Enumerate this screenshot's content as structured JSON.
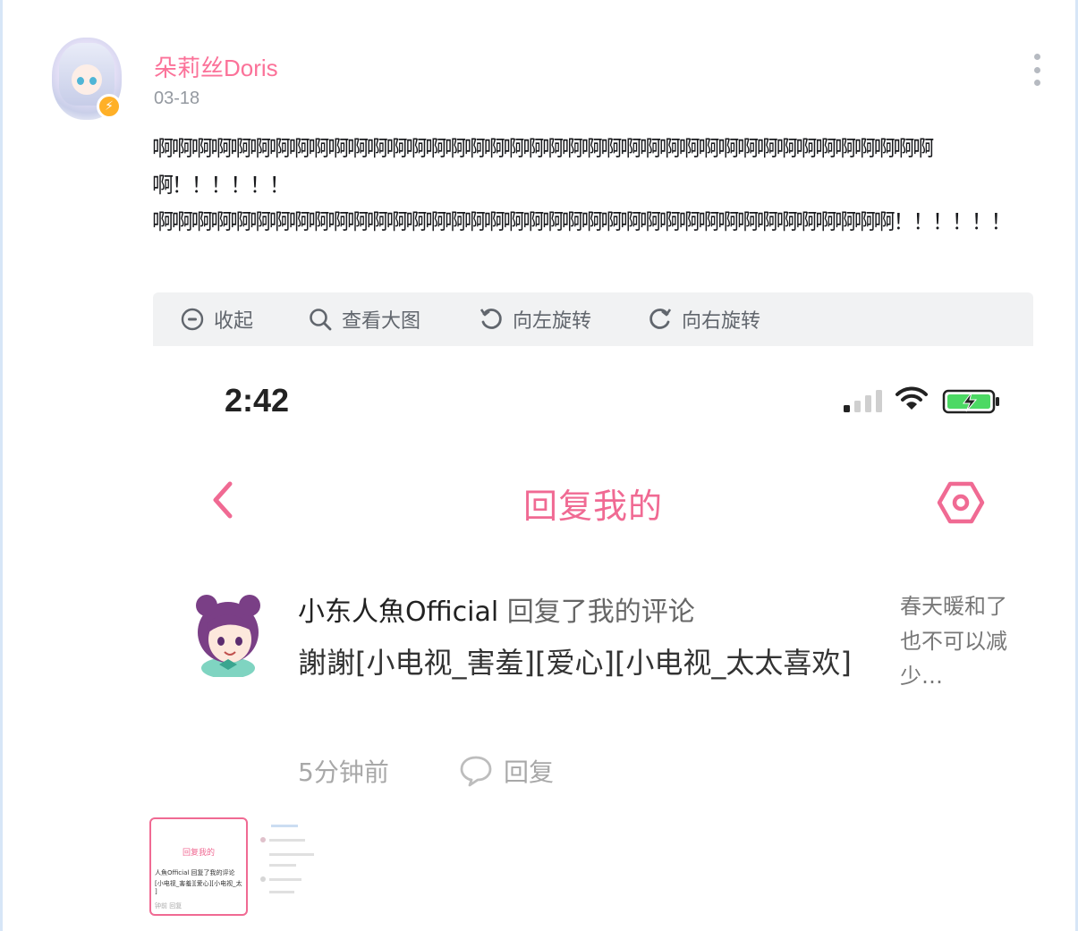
{
  "post": {
    "username": "朵莉丝Doris",
    "date": "03-18",
    "paragraphs": [
      "啊啊啊啊啊啊啊啊啊啊啊啊啊啊啊啊啊啊啊啊啊啊啊啊啊啊啊啊啊啊啊啊啊啊啊啊啊啊啊啊啊！！！！！！",
      "啊啊啊啊啊啊啊啊啊啊啊啊啊啊啊啊啊啊啊啊啊啊啊啊啊啊啊啊啊啊啊啊啊啊啊啊啊啊！！！！！！"
    ]
  },
  "toolbar": {
    "collapse_label": "收起",
    "view_label": "查看大图",
    "rotate_left_label": "向左旋转",
    "rotate_right_label": "向右旋转"
  },
  "screenshot": {
    "time": "2:42",
    "nav_title": "回复我的",
    "reply": {
      "author": "小东人魚Official",
      "action": " 回复了我的评论",
      "body": "謝謝[小电视_害羞][爱心][小电视_太太喜欢]",
      "quote": "春天暖和了也不可以减少…",
      "time": "5分钟前",
      "reply_label": "回复"
    }
  },
  "thumbnails": {
    "first": {
      "title": "回复我的",
      "line1": "人魚Official 回复了我的评论",
      "line2": "[小电视_害羞][爱心][小电视_太",
      "line3": "]",
      "line4": "钟前      回复"
    }
  },
  "colors": {
    "accent_pink": "#fb7299",
    "screenshot_pink": "#f06a93",
    "badge_orange": "#ffb027"
  },
  "icons": {
    "collapse": "circle-minus-icon",
    "view": "search-icon",
    "rotate_left": "rotate-left-icon",
    "rotate_right": "rotate-right-icon",
    "more": "more-vertical-icon"
  }
}
